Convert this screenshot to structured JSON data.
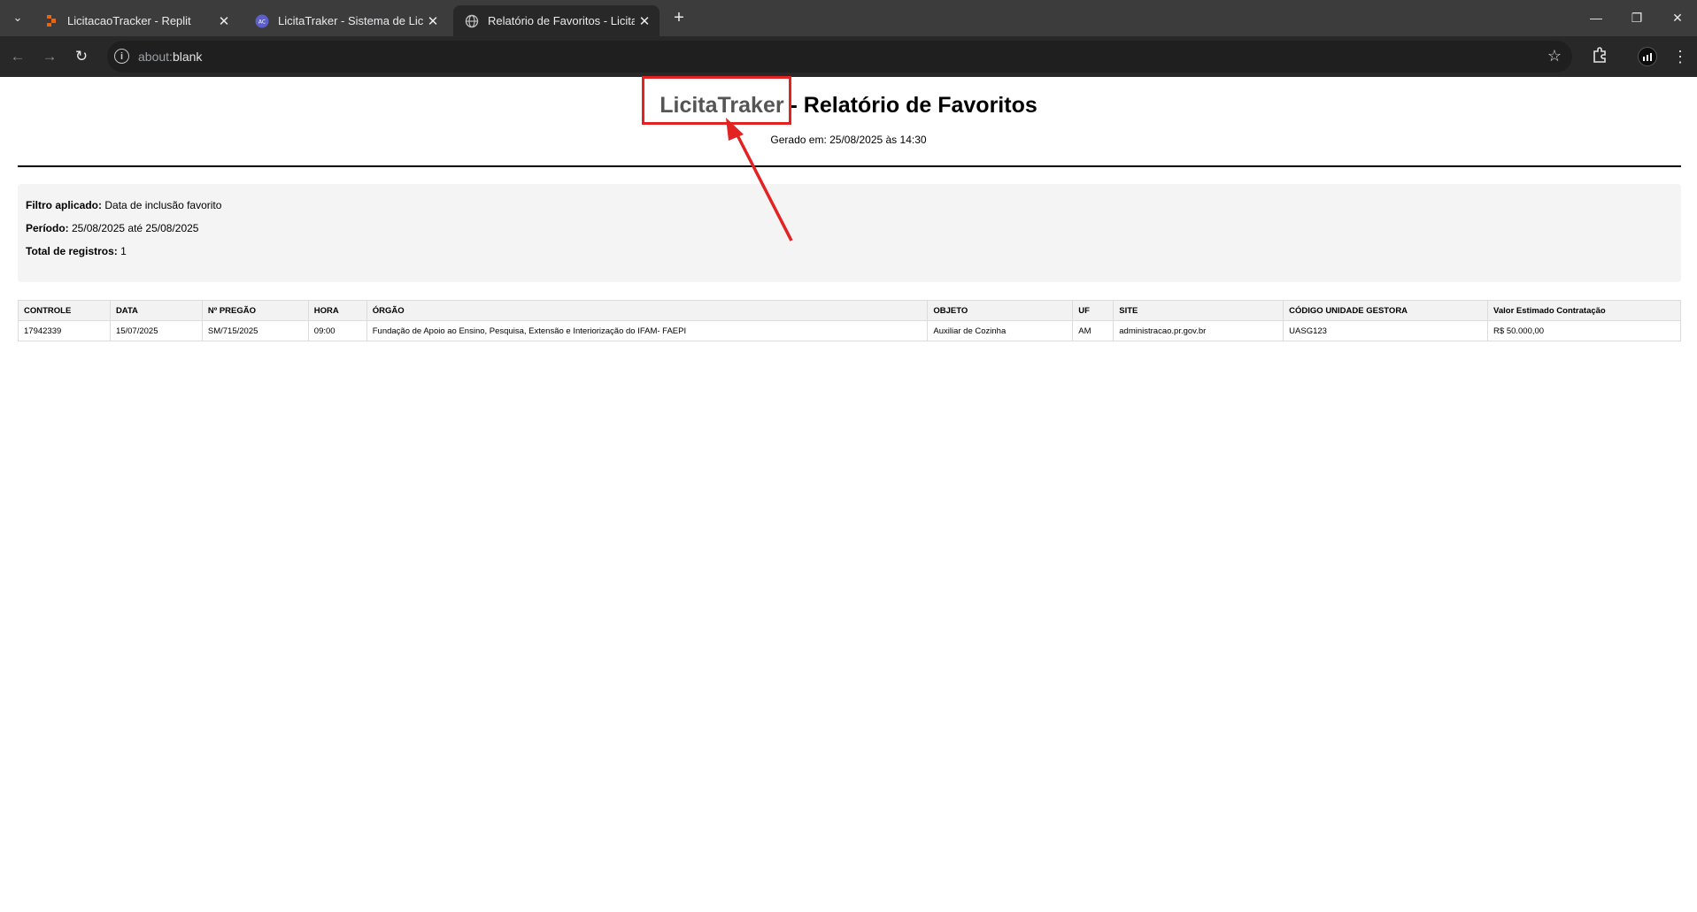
{
  "browser": {
    "tabs": [
      {
        "title": "LicitacaoTracker - Replit",
        "icon": "replit-icon",
        "active": false
      },
      {
        "title": "LicitaTraker - Sistema de Licitações",
        "icon": "app-icon",
        "active": false
      },
      {
        "title": "Relatório de Favoritos - LicitaTraker",
        "icon": "globe-icon",
        "active": true
      }
    ],
    "url_scheme": "about:",
    "url_rest": "blank"
  },
  "report": {
    "brand": "LicitaTraker",
    "title_rest": " - Relatório de Favoritos",
    "generated": "Gerado em: 25/08/2025 às 14:30",
    "filter_label": "Filtro aplicado:",
    "filter_value": " Data de inclusão favorito",
    "period_label": "Período:",
    "period_value": " 25/08/2025 até 25/08/2025",
    "total_label": "Total de registros:",
    "total_value": " 1"
  },
  "table": {
    "headers": [
      "CONTROLE",
      "DATA",
      "Nº PREGÃO",
      "HORA",
      "ÓRGÃO",
      "OBJETO",
      "UF",
      "SITE",
      "CÓDIGO UNIDADE GESTORA",
      "Valor Estimado Contratação"
    ],
    "rows": [
      [
        "17942339",
        "15/07/2025",
        "SM/715/2025",
        "09:00",
        "Fundação de Apoio ao Ensino, Pesquisa, Extensão e Interiorização do IFAM- FAEPI",
        "Auxiliar de Cozinha",
        "AM",
        "administracao.pr.gov.br",
        "UASG123",
        "R$ 50.000,00"
      ]
    ]
  },
  "colors": {
    "annotation": "#e32222",
    "tabbar": "#3c3c3c",
    "toolbar": "#282828"
  }
}
